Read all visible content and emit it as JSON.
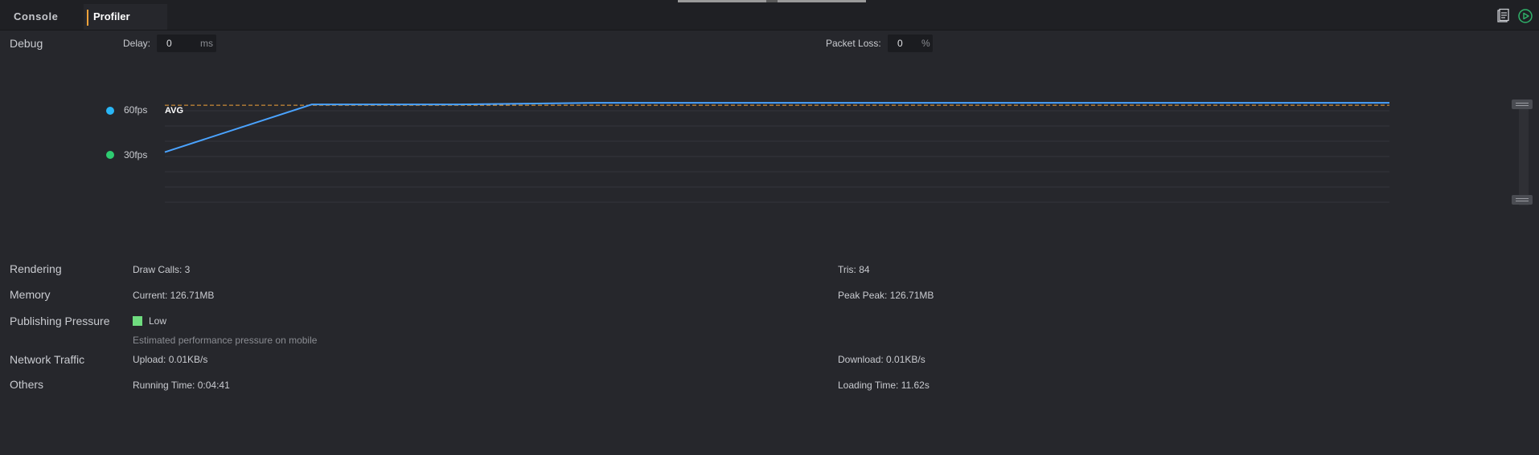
{
  "tabs": [
    {
      "label": "Console",
      "active": false
    },
    {
      "label": "Profiler",
      "active": true
    }
  ],
  "toolbar": {
    "copy_icon": "clipboard-icon",
    "play_icon": "play-circle-icon",
    "play_color": "#2fb36a"
  },
  "debug": {
    "section_label": "Debug",
    "delay_label": "Delay:",
    "delay_value": "0",
    "delay_unit": "ms",
    "packet_loss_label": "Packet Loss:",
    "packet_loss_value": "0",
    "packet_loss_unit": "%"
  },
  "fps_chart": {
    "legend": [
      {
        "label": "60fps",
        "color": "#29b6f6"
      },
      {
        "label": "30fps",
        "color": "#2ecc71"
      }
    ],
    "avg_label": "AVG",
    "avg_color": "#f0a23a",
    "line_color": "#4aa3ff",
    "chart_data": {
      "type": "line",
      "title": "",
      "series": [
        {
          "values": [
            30,
            59,
            59,
            60,
            60,
            60,
            60
          ]
        }
      ],
      "x": [
        0,
        150,
        300,
        440,
        700,
        1000,
        1250
      ],
      "avg": 58.5,
      "grid": true,
      "ylim": [
        0,
        62
      ]
    }
  },
  "stats": {
    "rendering": {
      "label": "Rendering",
      "draw_calls": "Draw Calls: 3",
      "tris": "Tris: 84"
    },
    "memory": {
      "label": "Memory",
      "current": "Current: 126.71MB",
      "peak": "Peak Peak: 126.71MB"
    },
    "pressure": {
      "label": "Publishing Pressure",
      "level": "Low",
      "level_color": "#6fdc7f",
      "note": "Estimated performance pressure on mobile"
    },
    "network": {
      "label": "Network Traffic",
      "upload": "Upload: 0.01KB/s",
      "download": "Download: 0.01KB/s"
    },
    "others": {
      "label": "Others",
      "running_time": "Running Time: 0:04:41",
      "loading_time": "Loading Time: 11.62s"
    }
  }
}
